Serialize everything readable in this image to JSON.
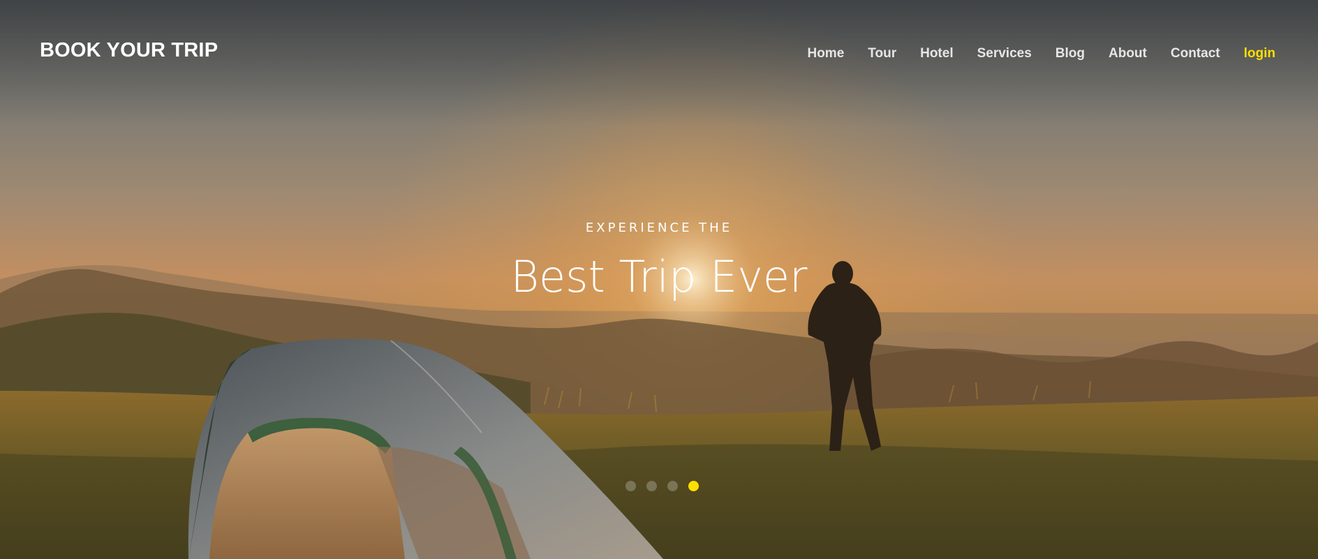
{
  "site": {
    "brand": "BOOK YOUR TRIP"
  },
  "nav": {
    "items": [
      {
        "label": "Home",
        "name": "nav-home"
      },
      {
        "label": "Tour",
        "name": "nav-tour"
      },
      {
        "label": "Hotel",
        "name": "nav-hotel"
      },
      {
        "label": "Services",
        "name": "nav-services"
      },
      {
        "label": "Blog",
        "name": "nav-blog"
      },
      {
        "label": "About",
        "name": "nav-about"
      },
      {
        "label": "Contact",
        "name": "nav-contact"
      },
      {
        "label": "login",
        "name": "nav-login"
      }
    ]
  },
  "hero": {
    "eyebrow": "EXPERIENCE THE",
    "headline": "Best Trip Ever",
    "slides_total": 4,
    "active_slide": 4,
    "background_image": "sunrise-camping-mountains-photo"
  },
  "colors": {
    "accent": "#ffdf00",
    "nav_text": "#e6e6e6",
    "hero_text": "#ffffff"
  }
}
